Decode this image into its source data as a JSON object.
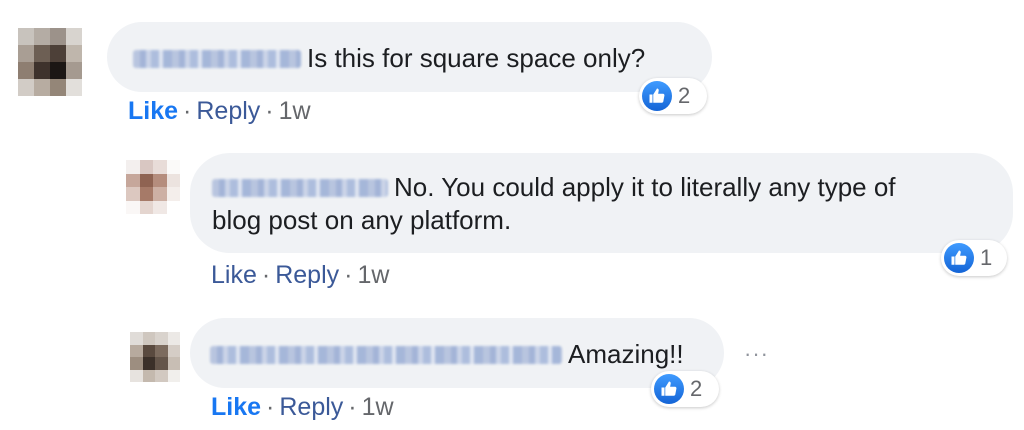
{
  "comments": [
    {
      "text": "Is this for square space only?",
      "actions": {
        "like": "Like",
        "sep": "·",
        "reply": "Reply",
        "time": "1w"
      },
      "reaction_count": "2"
    },
    {
      "text_line1": "No. You could apply it to literally any type of",
      "text_line2": "blog post on any platform.",
      "actions": {
        "like": "Like",
        "sep": "·",
        "reply": "Reply",
        "time": "1w"
      },
      "reaction_count": "1"
    },
    {
      "text": "Amazing!!",
      "actions": {
        "like": "Like",
        "sep": "·",
        "reply": "Reply",
        "time": "1w"
      },
      "reaction_count": "2",
      "more": "···"
    }
  ],
  "colors": {
    "bubble": "#f0f2f5",
    "like": "#1877f2",
    "link": "#3b5998",
    "meta": "#65676b"
  },
  "icons": {
    "reaction": "thumbs-up-icon",
    "more": "more-options-icon"
  }
}
